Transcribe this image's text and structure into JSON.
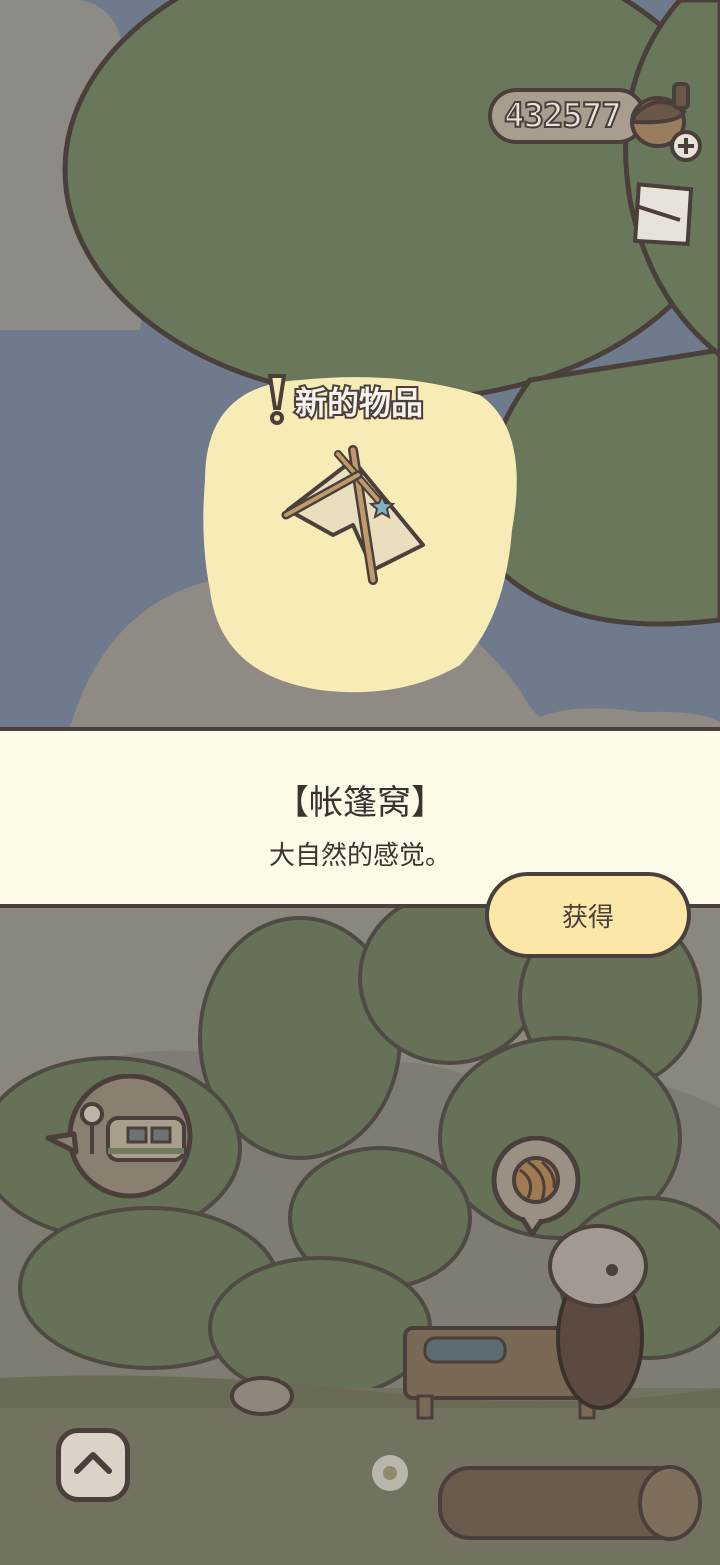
{
  "hud": {
    "currency_amount": "432577",
    "currency_icon": "acorn-icon",
    "add_icon": "plus-icon",
    "mail_icon": "letter-icon"
  },
  "popup": {
    "badge_label": "新的物品",
    "item_icon": "tent-icon"
  },
  "banner": {
    "item_name": "【帐篷窝】",
    "item_description": "大自然的感觉。",
    "obtain_label": "获得"
  },
  "scene": {
    "travel_bubble_icon": "camper-van-icon",
    "craft_bubble_icon": "yarn-ball-icon",
    "expand_icon": "chevron-up-icon"
  },
  "colors": {
    "outline": "#4a3f3a",
    "leaf_green": "#69785a",
    "highlight_yellow": "#f8ecb6",
    "banner_bg": "#fefbe8",
    "button_bg": "#fbe8a8",
    "sky": "#6f7a8c"
  }
}
